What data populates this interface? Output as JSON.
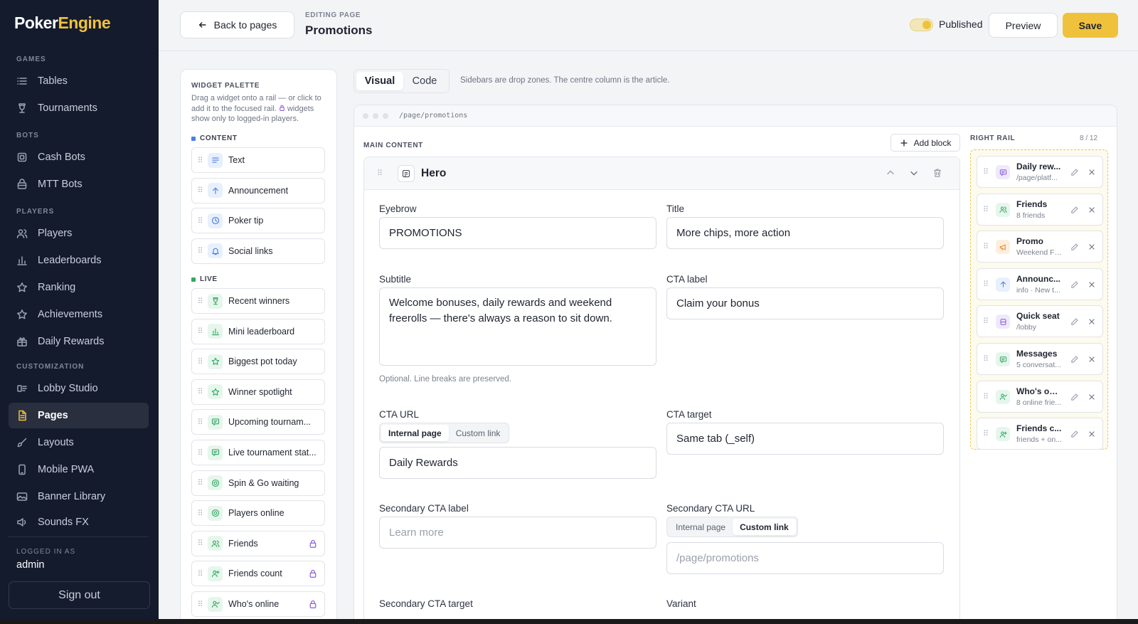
{
  "app": {
    "logo_a": "Poker",
    "logo_b": "Engine"
  },
  "sidebar": {
    "sections": [
      {
        "label": "GAMES",
        "items": [
          {
            "label": "Tables",
            "icon": "list-icon"
          },
          {
            "label": "Tournaments",
            "icon": "trophy-icon"
          }
        ]
      },
      {
        "label": "BOTS",
        "items": [
          {
            "label": "Cash Bots",
            "icon": "chip-icon"
          },
          {
            "label": "MTT Bots",
            "icon": "bot-icon"
          }
        ]
      },
      {
        "label": "PLAYERS",
        "items": [
          {
            "label": "Players",
            "icon": "users-icon"
          },
          {
            "label": "Leaderboards",
            "icon": "bar-chart-icon"
          },
          {
            "label": "Ranking",
            "icon": "star-icon"
          },
          {
            "label": "Achievements",
            "icon": "star-icon"
          },
          {
            "label": "Daily Rewards",
            "icon": "gift-icon"
          }
        ]
      },
      {
        "label": "CUSTOMIZATION",
        "items": [
          {
            "label": "Lobby Studio",
            "icon": "layout-icon"
          },
          {
            "label": "Pages",
            "icon": "file-icon",
            "active": true
          },
          {
            "label": "Layouts",
            "icon": "brush-icon"
          },
          {
            "label": "Mobile PWA",
            "icon": "phone-icon"
          },
          {
            "label": "Banner Library",
            "icon": "image-icon"
          },
          {
            "label": "Sounds FX",
            "icon": "speaker-icon"
          }
        ]
      }
    ],
    "logged_in_label": "LOGGED IN AS",
    "username": "admin",
    "sign_out": "Sign out"
  },
  "header": {
    "back": "Back to pages",
    "eyebrow": "EDITING PAGE",
    "title": "Promotions",
    "published_label": "Published",
    "published": true,
    "preview": "Preview",
    "save": "Save"
  },
  "palette": {
    "title": "WIDGET PALETTE",
    "desc_a": "Drag a widget onto a rail — or click to add it to the focused rail.",
    "desc_b": "widgets show only to logged-in players.",
    "groups": [
      {
        "label": "CONTENT",
        "color": "#4a7fe0",
        "items": [
          {
            "label": "Text",
            "icon": "text-icon",
            "tone": "blue"
          },
          {
            "label": "Announcement",
            "icon": "arrow-up-icon",
            "tone": "blue"
          },
          {
            "label": "Poker tip",
            "icon": "clock-icon",
            "tone": "blue"
          },
          {
            "label": "Social links",
            "icon": "bell-icon",
            "tone": "blue"
          }
        ]
      },
      {
        "label": "LIVE",
        "color": "#35a862",
        "items": [
          {
            "label": "Recent winners",
            "icon": "trophy-icon",
            "tone": "green"
          },
          {
            "label": "Mini leaderboard",
            "icon": "bar-chart-icon",
            "tone": "green"
          },
          {
            "label": "Biggest pot today",
            "icon": "star-icon",
            "tone": "green"
          },
          {
            "label": "Winner spotlight",
            "icon": "star-icon",
            "tone": "green"
          },
          {
            "label": "Upcoming tournam...",
            "icon": "message-icon",
            "tone": "green"
          },
          {
            "label": "Live tournament stat...",
            "icon": "message-icon",
            "tone": "green"
          },
          {
            "label": "Spin & Go waiting",
            "icon": "target-icon",
            "tone": "green"
          },
          {
            "label": "Players online",
            "icon": "target-icon",
            "tone": "green"
          },
          {
            "label": "Friends",
            "icon": "users-icon",
            "tone": "green",
            "locked": true
          },
          {
            "label": "Friends count",
            "icon": "user-plus-icon",
            "tone": "green",
            "locked": true
          },
          {
            "label": "Who's online",
            "icon": "user-check-icon",
            "tone": "green",
            "locked": true
          }
        ]
      }
    ]
  },
  "editor": {
    "tabs": [
      "Visual",
      "Code"
    ],
    "active_tab": "Visual",
    "hint": "Sidebars are drop zones. The centre column is the article.",
    "path": "/page/promotions",
    "main_label": "MAIN CONTENT",
    "add_block": "Add block",
    "block": {
      "name": "Hero",
      "eyebrow_label": "Eyebrow",
      "eyebrow": "PROMOTIONS",
      "title_label": "Title",
      "title": "More chips, more action",
      "subtitle_label": "Subtitle",
      "subtitle": "Welcome bonuses, daily rewards and weekend freerolls — there's always a reason to sit down.",
      "subtitle_help": "Optional. Line breaks are preserved.",
      "cta_label_label": "CTA label",
      "cta_label": "Claim your bonus",
      "cta_url_label": "CTA URL",
      "cta_url_modes": [
        "Internal page",
        "Custom link"
      ],
      "cta_url_mode": "Internal page",
      "cta_url": "Daily Rewards",
      "cta_target_label": "CTA target",
      "cta_target": "Same tab (_self)",
      "sec_label_label": "Secondary CTA label",
      "sec_label_placeholder": "Learn more",
      "sec_url_label": "Secondary CTA URL",
      "sec_url_modes": [
        "Internal page",
        "Custom link"
      ],
      "sec_url_mode": "Custom link",
      "sec_url_placeholder": "/page/promotions",
      "sec_target_label": "Secondary CTA target",
      "variant_label": "Variant"
    },
    "rail": {
      "title": "RIGHT RAIL",
      "count": "8 / 12",
      "items": [
        {
          "title": "Daily rew...",
          "sub": "/page/platf...",
          "icon": "message-icon",
          "tone": "purple"
        },
        {
          "title": "Friends",
          "sub": "8 friends",
          "icon": "users-icon",
          "tone": "green"
        },
        {
          "title": "Promo",
          "sub": "Weekend Fr...",
          "icon": "megaphone-icon",
          "tone": "orange"
        },
        {
          "title": "Announc...",
          "sub": "info · New t...",
          "icon": "arrow-up-icon",
          "tone": "blue"
        },
        {
          "title": "Quick seat",
          "sub": "/lobby",
          "icon": "chair-icon",
          "tone": "purple"
        },
        {
          "title": "Messages",
          "sub": "5 conversat...",
          "icon": "message-icon",
          "tone": "green"
        },
        {
          "title": "Who's onl...",
          "sub": "8 online frie...",
          "icon": "user-check-icon",
          "tone": "green"
        },
        {
          "title": "Friends c...",
          "sub": "friends + on...",
          "icon": "user-plus-icon",
          "tone": "green"
        }
      ]
    }
  }
}
